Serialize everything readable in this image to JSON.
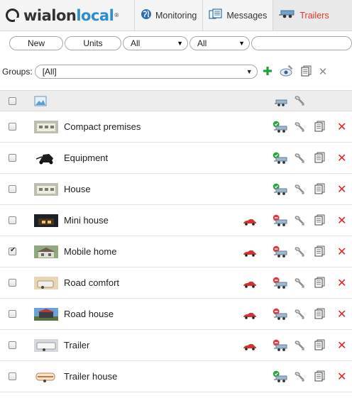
{
  "app": {
    "logo_main": "wialon",
    "logo_accent": "local",
    "logo_sup": "®"
  },
  "tabs": [
    {
      "label": "Monitoring",
      "icon": "globe-icon"
    },
    {
      "label": "Messages",
      "icon": "messages-icon"
    },
    {
      "label": "Trailers",
      "icon": "trailer-icon",
      "active": true
    }
  ],
  "filters": {
    "new_label": "New",
    "units_label": "Units",
    "select1_value": "All",
    "select2_value": "All",
    "search_value": ""
  },
  "groups": {
    "label": "Groups:",
    "value": "[All]"
  },
  "colors": {
    "accent": "#e8342c",
    "brand_blue": "#2d8dd1",
    "add_green": "#1fa035",
    "delete_red": "#e02020",
    "status_green": "#22a838",
    "status_red": "#e03a3a"
  },
  "trailers": [
    {
      "name": "Compact premises",
      "checked": false,
      "bound": false,
      "status": "green",
      "thumb": "building"
    },
    {
      "name": "Equipment",
      "checked": false,
      "bound": false,
      "status": "green",
      "thumb": "equipment"
    },
    {
      "name": "House",
      "checked": false,
      "bound": false,
      "status": "green",
      "thumb": "building"
    },
    {
      "name": "Mini house",
      "checked": false,
      "bound": true,
      "status": "red",
      "thumb": "night"
    },
    {
      "name": "Mobile home",
      "checked": true,
      "bound": true,
      "status": "red",
      "thumb": "house"
    },
    {
      "name": "Road comfort",
      "checked": false,
      "bound": true,
      "status": "red",
      "thumb": "sand"
    },
    {
      "name": "Road house",
      "checked": false,
      "bound": true,
      "status": "red",
      "thumb": "sky"
    },
    {
      "name": "Trailer",
      "checked": false,
      "bound": true,
      "status": "red",
      "thumb": "grey"
    },
    {
      "name": "Trailer house",
      "checked": false,
      "bound": false,
      "status": "green",
      "thumb": "caravan"
    }
  ]
}
